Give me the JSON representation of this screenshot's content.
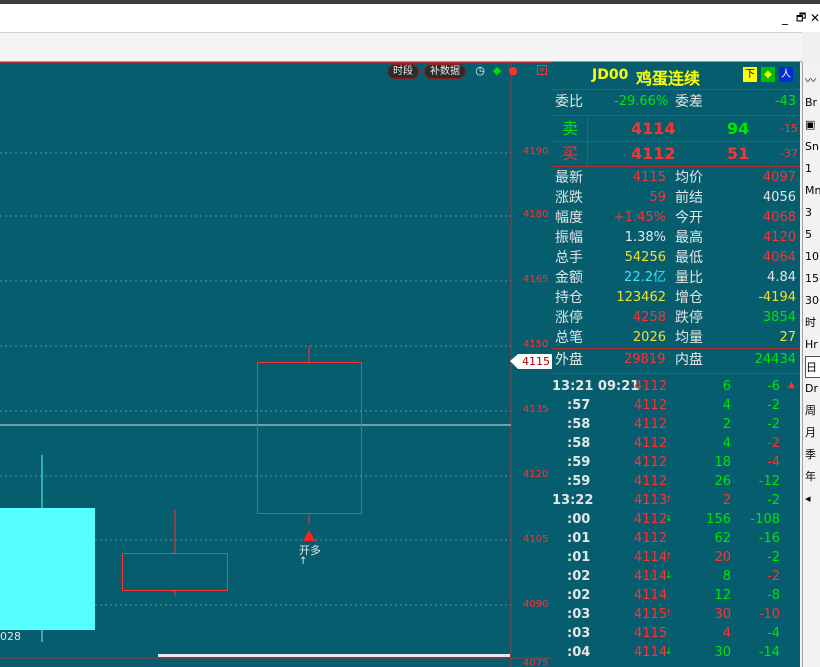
{
  "window": {
    "minimize": "_",
    "restore": "🗗",
    "close": "✕"
  },
  "chart_toolbar": {
    "period_btn": "时段",
    "fill_btn": "补数据"
  },
  "chart": {
    "price_labels": [
      "4190",
      "4180",
      "4165",
      "4150",
      "4135",
      "4120",
      "4105",
      "4090",
      "4075"
    ],
    "current_price_tag": "4115",
    "candle_label_main": "开多",
    "candle_label_sub": "↑",
    "left_label": "028"
  },
  "colors": {
    "chart_bg": "#055d6e",
    "up": "#ff3232",
    "down": "#00e600",
    "cyan_candle": "#55ffff",
    "grid": "#b03030"
  },
  "quote": {
    "code": "JD00",
    "name": "鸡蛋连续",
    "btn_down": "下",
    "btn_diamond": "◆",
    "btn_person": "人",
    "weibi_label": "委比",
    "weibi_value": "-29.66%",
    "weicha_label": "委差",
    "weicha_value": "-43",
    "sell_label": "卖",
    "sell_price": "4114",
    "sell_vol": "94",
    "sell_change": "-15",
    "buy_label": "买",
    "buy_price": "4112",
    "buy_vol": "51",
    "buy_change": "-37",
    "stats": [
      {
        "l1": "最新",
        "v1": "4115",
        "c1": "red",
        "l2": "均价",
        "v2": "4097",
        "c2": "red"
      },
      {
        "l1": "涨跌",
        "v1": "59",
        "c1": "red",
        "l2": "前结",
        "v2": "4056",
        "c2": "white"
      },
      {
        "l1": "幅度",
        "v1": "+1.45%",
        "c1": "red",
        "l2": "今开",
        "v2": "4068",
        "c2": "red"
      },
      {
        "l1": "振幅",
        "v1": "1.38%",
        "c1": "white",
        "l2": "最高",
        "v2": "4120",
        "c2": "red"
      },
      {
        "l1": "总手",
        "v1": "54256",
        "c1": "yellow",
        "l2": "最低",
        "v2": "4064",
        "c2": "red"
      },
      {
        "l1": "金额",
        "v1": "22.2亿",
        "c1": "cyan",
        "l2": "量比",
        "v2": "4.84",
        "c2": "white"
      },
      {
        "l1": "持仓",
        "v1": "123462",
        "c1": "yellow",
        "l2": "增仓",
        "v2": "-4194",
        "c2": "yellow"
      },
      {
        "l1": "涨停",
        "v1": "4258",
        "c1": "red",
        "l2": "跌停",
        "v2": "3854",
        "c2": "green"
      },
      {
        "l1": "总笔",
        "v1": "2026",
        "c1": "yellow",
        "l2": "均量",
        "v2": "27",
        "c2": "yellow"
      }
    ],
    "outer_label": "外盘",
    "outer_value": "29819",
    "inner_label": "内盘",
    "inner_value": "24434"
  },
  "ticks": [
    {
      "time": "13:21 09:21",
      "price": "4112",
      "arrow": "",
      "vol": "6",
      "vc": "green",
      "chg": "-6",
      "cc": "green"
    },
    {
      "time": ":57",
      "price": "4112",
      "arrow": "",
      "vol": "4",
      "vc": "green",
      "chg": "-2",
      "cc": "green"
    },
    {
      "time": ":58",
      "price": "4112",
      "arrow": "",
      "vol": "2",
      "vc": "green",
      "chg": "-2",
      "cc": "green"
    },
    {
      "time": ":58",
      "price": "4112",
      "arrow": "",
      "vol": "4",
      "vc": "green",
      "chg": "-2",
      "cc": "red"
    },
    {
      "time": ":59",
      "price": "4112",
      "arrow": "",
      "vol": "18",
      "vc": "green",
      "chg": "-4",
      "cc": "red"
    },
    {
      "time": ":59",
      "price": "4112",
      "arrow": "",
      "vol": "26",
      "vc": "green",
      "chg": "-12",
      "cc": "green"
    },
    {
      "time": "13:22",
      "price": "4113",
      "arrow": "↑",
      "vol": "2",
      "vc": "red",
      "chg": "-2",
      "cc": "green"
    },
    {
      "time": ":00",
      "price": "4112",
      "arrow": "↓",
      "vol": "156",
      "vc": "green",
      "chg": "-108",
      "cc": "green"
    },
    {
      "time": ":01",
      "price": "4112",
      "arrow": "",
      "vol": "62",
      "vc": "green",
      "chg": "-16",
      "cc": "green"
    },
    {
      "time": ":01",
      "price": "4114",
      "arrow": "↑",
      "vol": "20",
      "vc": "red",
      "chg": "-2",
      "cc": "green"
    },
    {
      "time": ":02",
      "price": "4114",
      "arrow": "↓",
      "vol": "8",
      "vc": "green",
      "chg": "-2",
      "cc": "red"
    },
    {
      "time": ":02",
      "price": "4114",
      "arrow": "",
      "vol": "12",
      "vc": "green",
      "chg": "-8",
      "cc": "green"
    },
    {
      "time": ":03",
      "price": "4115",
      "arrow": "↑",
      "vol": "30",
      "vc": "red",
      "chg": "-10",
      "cc": "red"
    },
    {
      "time": ":03",
      "price": "4115",
      "arrow": "",
      "vol": "4",
      "vc": "red",
      "chg": "-4",
      "cc": "green"
    },
    {
      "time": ":04",
      "price": "4114",
      "arrow": "↓",
      "vol": "30",
      "vc": "green",
      "chg": "-14",
      "cc": "green"
    }
  ],
  "sidebar": {
    "items": [
      "",
      "Br",
      "",
      "Sn",
      "1",
      "Mn",
      "3",
      "5",
      "10",
      "15",
      "30",
      "时",
      "Hr",
      "日",
      "Dr",
      "周",
      "月",
      "季",
      "年",
      "◂"
    ]
  }
}
